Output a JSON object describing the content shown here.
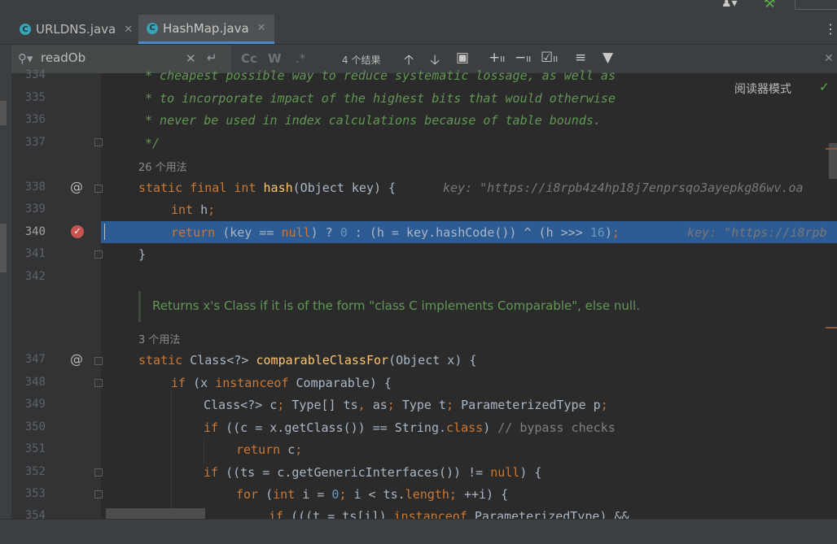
{
  "tabs": [
    {
      "label": "URLDNS.java",
      "active": false
    },
    {
      "label": "HashMap.java",
      "active": true
    }
  ],
  "search": {
    "value": "readOb",
    "case_label": "Cc",
    "word_label": "W",
    "regex_label": ".*",
    "results": "4 个结果"
  },
  "reader_mode": "阅读器模式",
  "usages": {
    "hash": "26 个用法",
    "comparableClassFor": "3 个用法"
  },
  "doc_comment": "Returns x's Class if it is of the form \"class C implements Comparable\", else null.",
  "line_numbers": {
    "l334": "334",
    "l335": "335",
    "l336": "336",
    "l337": "337",
    "l338": "338",
    "l339": "339",
    "l340": "340",
    "l341": "341",
    "l342": "342",
    "l347": "347",
    "l348": "348",
    "l349": "349",
    "l350": "350",
    "l351": "351",
    "l352": "352",
    "l353": "353",
    "l354": "354"
  },
  "comments": {
    "c334": "* cheapest possible way to reduce systematic lossage, as well as",
    "c335": "* to incorporate impact of the highest bits that would otherwise",
    "c336": "* never be used in index calculations because of table bounds.",
    "c337": "*/",
    "c350": "// bypass checks"
  },
  "inline_hints": {
    "h338": "key: \"https://i8rpb4z4hp18j7enprsqo3ayepkg86wv.oa",
    "h340": "key: \"https://i8rpb"
  },
  "colors": {
    "keyword": "#cc7832",
    "function": "#ffc66d",
    "number": "#6897bb",
    "comment": "#629755",
    "highlight": "#2d5b94"
  }
}
